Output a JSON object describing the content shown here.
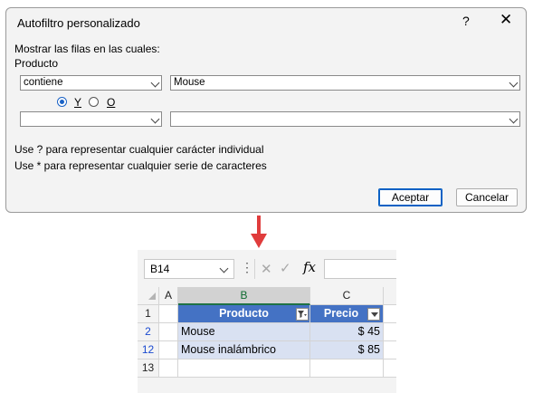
{
  "dialog": {
    "title": "Autofiltro personalizado",
    "help": "?",
    "close": "✕",
    "show_rows_label": "Mostrar las filas en las cuales:",
    "field_label": "Producto",
    "row1": {
      "operator": "contiene",
      "value": "Mouse"
    },
    "row2": {
      "operator": "",
      "value": ""
    },
    "radio_and": "Y",
    "radio_or": "O",
    "radio_selected": "Y",
    "hint1": "Use ? para representar cualquier carácter individual",
    "hint2": "Use * para representar cualquier serie de caracteres",
    "ok": "Aceptar",
    "cancel": "Cancelar"
  },
  "excel": {
    "name_box": "B14",
    "dots": "⋮",
    "cancel_icon": "✕",
    "enter_icon": "✓",
    "fx": "fx",
    "formula": "",
    "columns": [
      "A",
      "B",
      "C"
    ],
    "selected_column": "B",
    "rows": [
      {
        "num": "1",
        "filtered": false,
        "a": "",
        "b": "Producto",
        "c": "Precio"
      },
      {
        "num": "2",
        "filtered": true,
        "a": "",
        "b": "Mouse",
        "c": "$ 45"
      },
      {
        "num": "12",
        "filtered": true,
        "a": "",
        "b": "Mouse inalámbrico",
        "c": "$ 85"
      },
      {
        "num": "13",
        "filtered": false,
        "a": "",
        "b": "",
        "c": ""
      }
    ],
    "colors": {
      "header_fill": "#4472c4",
      "band_fill": "#d9e1f2",
      "filtered_row_number": "#1a4ad0",
      "arrow": "#e03c3c"
    }
  }
}
